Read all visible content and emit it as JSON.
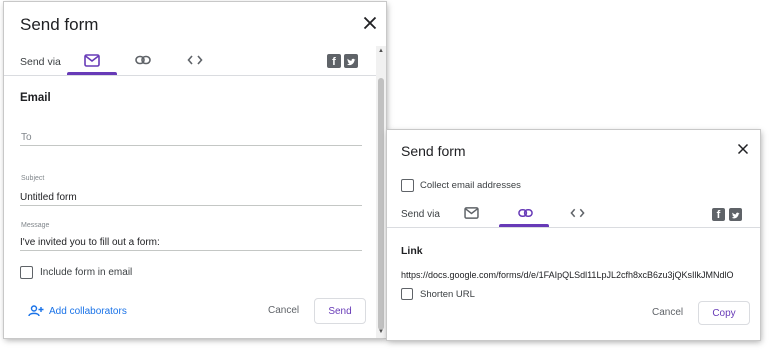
{
  "email_dialog": {
    "title": "Send form",
    "send_via_label": "Send via",
    "tabs": [
      {
        "name": "email",
        "icon": "mail-icon",
        "active": true
      },
      {
        "name": "link",
        "icon": "link-icon",
        "active": false
      },
      {
        "name": "embed",
        "icon": "code-icon",
        "active": false
      }
    ],
    "social": [
      "facebook-icon",
      "twitter-icon"
    ],
    "section_title": "Email",
    "to": {
      "placeholder": "To",
      "value": ""
    },
    "subject": {
      "label": "Subject",
      "value": "Untitled form"
    },
    "message": {
      "label": "Message",
      "value": "I've invited you to fill out a form:"
    },
    "include_form_label": "Include form in email",
    "include_form_checked": false,
    "add_collaborators_label": "Add collaborators",
    "cancel_label": "Cancel",
    "send_label": "Send"
  },
  "link_dialog": {
    "title": "Send form",
    "collect_email_label": "Collect email addresses",
    "collect_email_checked": false,
    "send_via_label": "Send via",
    "tabs": [
      {
        "name": "email",
        "icon": "mail-icon",
        "active": false
      },
      {
        "name": "link",
        "icon": "link-icon",
        "active": true
      },
      {
        "name": "embed",
        "icon": "code-icon",
        "active": false
      }
    ],
    "social": [
      "facebook-icon",
      "twitter-icon"
    ],
    "section_title": "Link",
    "url": "https://docs.google.com/forms/d/e/1FAIpQLSdl11LpJL2cfh8xcB6zu3jQKsIlkJMNdlO",
    "shorten_url_label": "Shorten URL",
    "shorten_url_checked": false,
    "cancel_label": "Cancel",
    "copy_label": "Copy"
  },
  "colors": {
    "accent": "#673ab7",
    "link": "#1a73e8",
    "icon": "#5f6368"
  }
}
